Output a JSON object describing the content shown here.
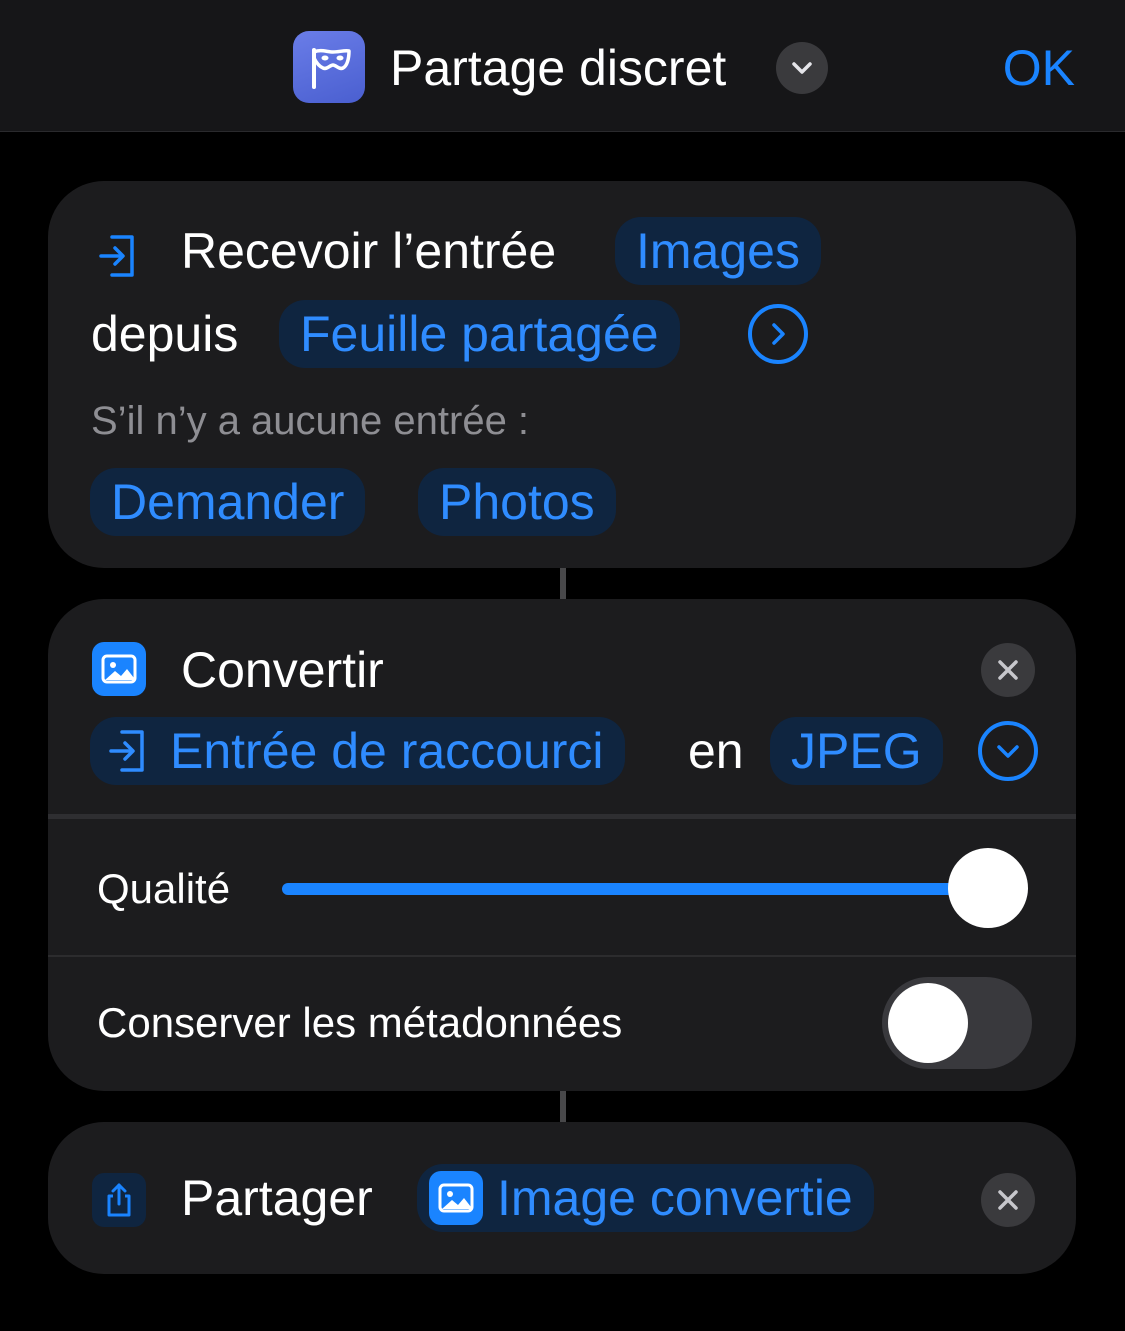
{
  "header": {
    "title": "Partage discret",
    "ok_label": "OK"
  },
  "receive_action": {
    "title": "Recevoir l’entrée",
    "input_type": "Images",
    "from_label": "depuis",
    "source": "Feuille partagée",
    "no_input_label": "S’il n’y a aucune entrée :",
    "fallback_action": "Demander",
    "fallback_source": "Photos"
  },
  "convert_action": {
    "title": "Convertir",
    "input": "Entrée de raccourci",
    "to_label": "en",
    "format": "JPEG",
    "quality_label": "Qualité",
    "quality_value": 1.0,
    "metadata_label": "Conserver les métadonnées",
    "metadata_enabled": false
  },
  "share_action": {
    "title": "Partager",
    "input": "Image convertie"
  },
  "colors": {
    "accent": "#1a84ff",
    "card": "#1c1c1e",
    "background": "#000000",
    "pill": "#0f2540",
    "secondary_text": "#8e8e93",
    "app_icon": "#5468d8"
  },
  "icons": {
    "app": "mask-icon",
    "receive": "input-arrow-icon",
    "convert": "image-icon",
    "share": "share-icon",
    "expand": "chevron-down-icon",
    "details": "chevron-right-icon",
    "remove": "close-icon"
  }
}
